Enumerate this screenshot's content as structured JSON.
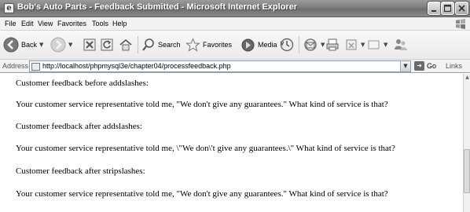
{
  "window": {
    "title": "Bob's Auto Parts - Feedback Submitted - Microsoft Internet Explorer",
    "app_icon": "ie-page-icon"
  },
  "menu": {
    "items": [
      "File",
      "Edit",
      "View",
      "Favorites",
      "Tools",
      "Help"
    ]
  },
  "toolbar": {
    "back_label": "Back",
    "search_label": "Search",
    "favorites_label": "Favorites",
    "media_label": "Media"
  },
  "address": {
    "label": "Address",
    "url": "http://localhost/phpmysql3e/chapter04/processfeedback.php",
    "go_label": "Go",
    "links_label": "Links"
  },
  "content": {
    "lines": [
      "Customer feedback before addslashes:",
      "Your customer service representative told me, \"We don't give any guarantees.\" What kind of service is that?",
      "Customer feedback after addslashes:",
      "Your customer service representative told me, \\\"We don\\'t give any guarantees.\\\" What kind of service is that?",
      "Customer feedback after stripslashes:",
      "Your customer service representative told me, \"We don't give any guarantees.\" What kind of service is that?"
    ]
  },
  "colors": {
    "titlebar": "#7e7e7e",
    "chrome": "#f2f2f2",
    "content_bg": "#ffffff"
  }
}
